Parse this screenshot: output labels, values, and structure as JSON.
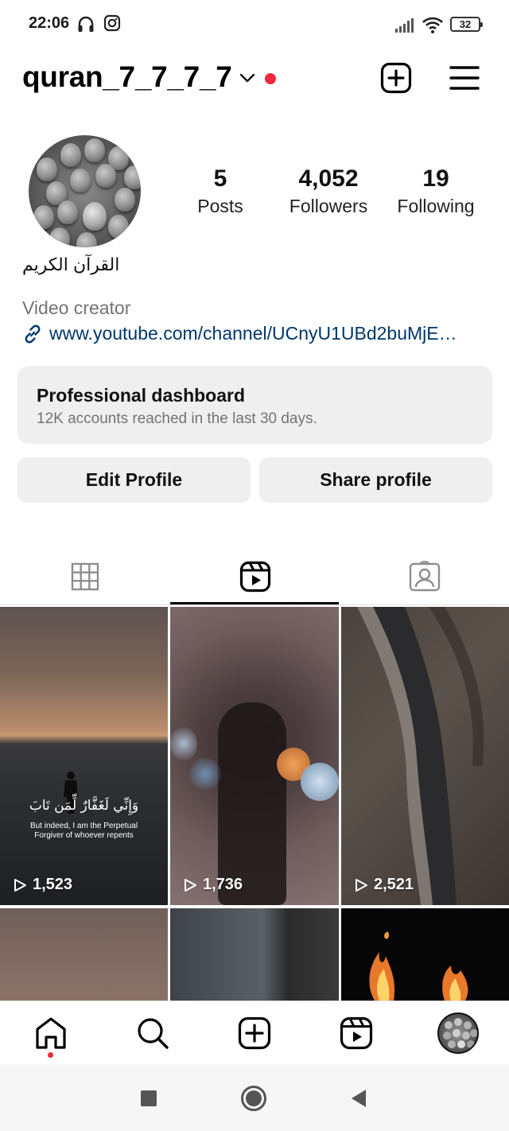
{
  "status_bar": {
    "time": "22:06",
    "battery": "32",
    "icons": [
      "headphones-icon",
      "instagram-icon",
      "signal-icon",
      "wifi-icon",
      "battery-icon"
    ]
  },
  "header": {
    "username": "quran_7_7_7_7",
    "icons": [
      "chevron-down-icon",
      "notification-dot",
      "new-post-icon",
      "menu-icon"
    ]
  },
  "profile": {
    "stats": [
      {
        "value": "5",
        "label": "Posts"
      },
      {
        "value": "4,052",
        "label": "Followers"
      },
      {
        "value": "19",
        "label": "Following"
      }
    ],
    "display_name": "القرآن الكريم",
    "category": "Video creator",
    "link": "www.youtube.com/channel/UCnyU1UBd2buMjE…"
  },
  "dashboard": {
    "title": "Professional dashboard",
    "subtitle": "12K accounts reached in the last 30 days."
  },
  "buttons": {
    "edit_profile": "Edit Profile",
    "share_profile": "Share profile"
  },
  "tabs": [
    {
      "name": "grid",
      "icon": "grid-icon",
      "active": false
    },
    {
      "name": "reels",
      "icon": "reels-icon",
      "active": true
    },
    {
      "name": "tagged",
      "icon": "tagged-icon",
      "active": false
    }
  ],
  "grid": {
    "tiles": [
      {
        "views": "1,523",
        "caption_ar": "وَإِنِّي لَغَفَّارٌ لِّمَن تَابَ",
        "caption_en_1": "But indeed, I am the Perpetual",
        "caption_en_2": "Forgiver of whoever repents"
      },
      {
        "views": "1,736"
      },
      {
        "views": "2,521"
      },
      {
        "views": ""
      },
      {
        "views": ""
      },
      {
        "views": ""
      }
    ]
  },
  "bottom_nav": {
    "items": [
      "home-icon",
      "search-icon",
      "create-icon",
      "reels-icon",
      "profile-avatar"
    ]
  },
  "system_nav": {
    "items": [
      "recents-button",
      "home-button",
      "back-button"
    ]
  },
  "colors": {
    "accent_red": "#ee2a3c",
    "link_blue": "#00376b",
    "secondary_text": "#737373",
    "button_bg": "#efefef"
  }
}
